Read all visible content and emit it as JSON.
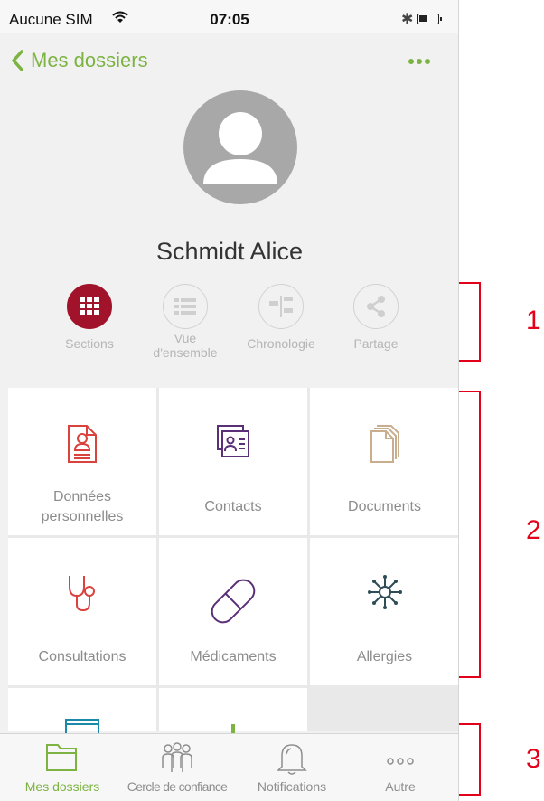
{
  "status_bar": {
    "carrier": "Aucune SIM",
    "time": "07:05"
  },
  "nav": {
    "back_label": "Mes dossiers",
    "more_label": "•••"
  },
  "profile": {
    "name": "Schmidt Alice"
  },
  "view_tabs": [
    {
      "label": "Sections",
      "active": true,
      "icon": "grid-icon"
    },
    {
      "label": "Vue d'ensemble",
      "active": false,
      "icon": "list-icon"
    },
    {
      "label": "Chronologie",
      "active": false,
      "icon": "timeline-icon"
    },
    {
      "label": "Partage",
      "active": false,
      "icon": "share-icon"
    }
  ],
  "sections": [
    {
      "label": "Données personnelles",
      "icon": "personal-data-icon",
      "color": "#d9423d"
    },
    {
      "label": "Contacts",
      "icon": "contacts-icon",
      "color": "#5b2f78"
    },
    {
      "label": "Documents",
      "icon": "documents-icon",
      "color": "#c9ad8f"
    },
    {
      "label": "Consultations",
      "icon": "stethoscope-icon",
      "color": "#d9423d"
    },
    {
      "label": "Médicaments",
      "icon": "pill-icon",
      "color": "#5b2f78"
    },
    {
      "label": "Allergies",
      "icon": "allergy-icon",
      "color": "#2f4d57"
    }
  ],
  "bottom_tabs": [
    {
      "label": "Mes dossiers",
      "active": true,
      "icon": "folder-icon"
    },
    {
      "label": "Cercle de confiance",
      "active": false,
      "icon": "people-icon"
    },
    {
      "label": "Notifications",
      "active": false,
      "icon": "bell-icon"
    },
    {
      "label": "Autre",
      "active": false,
      "icon": "more-icon"
    }
  ],
  "annotations": [
    "1",
    "2",
    "3"
  ],
  "colors": {
    "accent_green": "#7cb342",
    "active_tab_red": "#a1132a",
    "annotation_red": "#e3001b"
  }
}
